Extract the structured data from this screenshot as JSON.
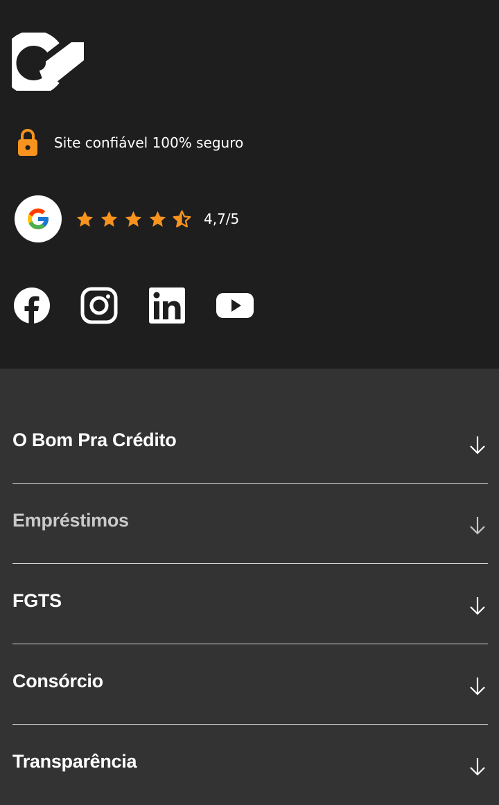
{
  "brand": {
    "logo_icon": "bom-pra-credito-logo"
  },
  "security": {
    "icon": "lock-icon",
    "text": "Site confiável 100% seguro",
    "accent": "#f7931e"
  },
  "google_rating": {
    "icon": "google-icon",
    "rating": 4.7,
    "max": 5,
    "full_stars": 4,
    "half_stars": 1,
    "text": "4,7/5",
    "star_color": "#f7931e"
  },
  "social": [
    {
      "name": "facebook",
      "icon": "facebook-icon"
    },
    {
      "name": "instagram",
      "icon": "instagram-icon"
    },
    {
      "name": "linkedin",
      "icon": "linkedin-icon"
    },
    {
      "name": "youtube",
      "icon": "youtube-icon"
    }
  ],
  "menu": {
    "items": [
      {
        "label": "O Bom Pra Crédito",
        "icon": "arrow-down-icon"
      },
      {
        "label": "Empréstimos",
        "icon": "arrow-down-icon",
        "muted": true
      },
      {
        "label": "FGTS",
        "icon": "arrow-down-icon"
      },
      {
        "label": "Consórcio",
        "icon": "arrow-down-icon"
      },
      {
        "label": "Transparência",
        "icon": "arrow-down-icon"
      }
    ]
  },
  "colors": {
    "top_bg": "#1e1e1e",
    "bottom_bg": "#333333",
    "accent": "#f7931e",
    "divider": "#d8d8d8"
  }
}
